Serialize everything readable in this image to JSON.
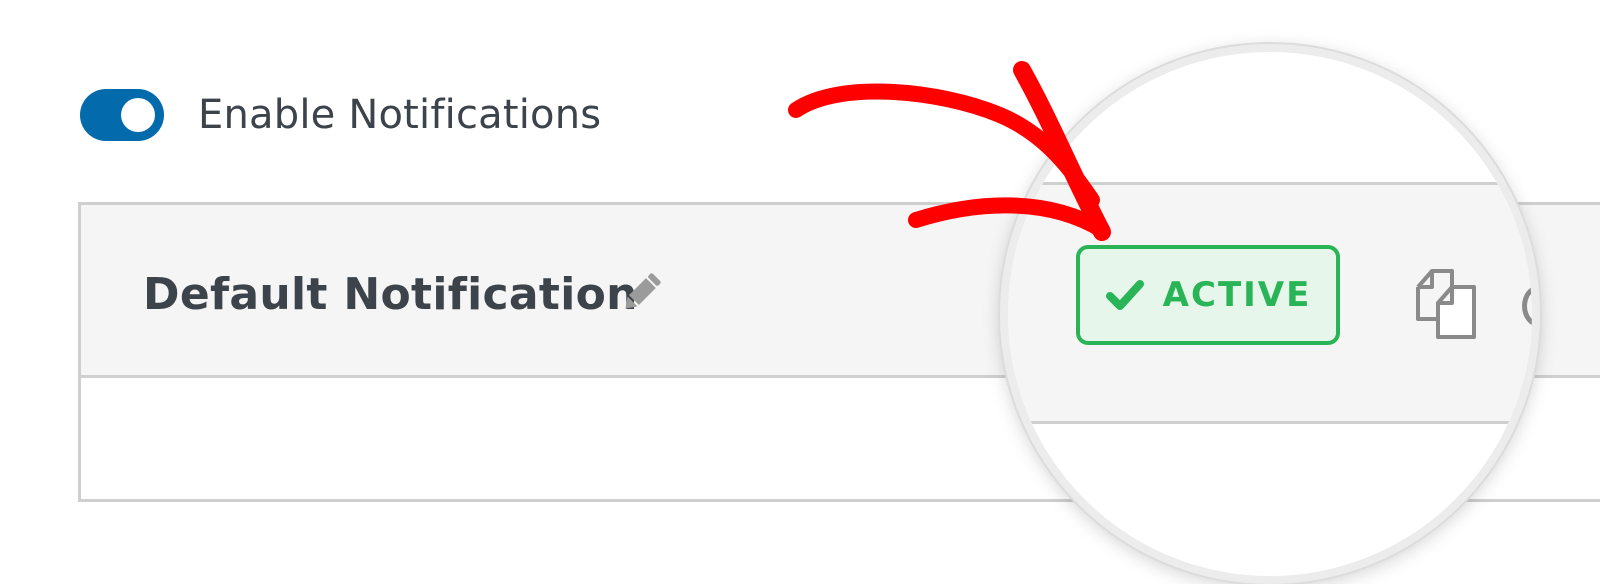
{
  "settings": {
    "toggle_label": "Enable Notifications",
    "toggle_state": "on",
    "toggle_color": "#036aab"
  },
  "notification": {
    "title": "Default Notification",
    "status_label": "ACTIVE",
    "status_color": "#2ab458"
  },
  "icons": {
    "edit": "pencil-icon",
    "status": "checkmark-icon",
    "duplicate": "duplicate-icon"
  },
  "annotation": {
    "arrow_color": "#ff0000"
  }
}
